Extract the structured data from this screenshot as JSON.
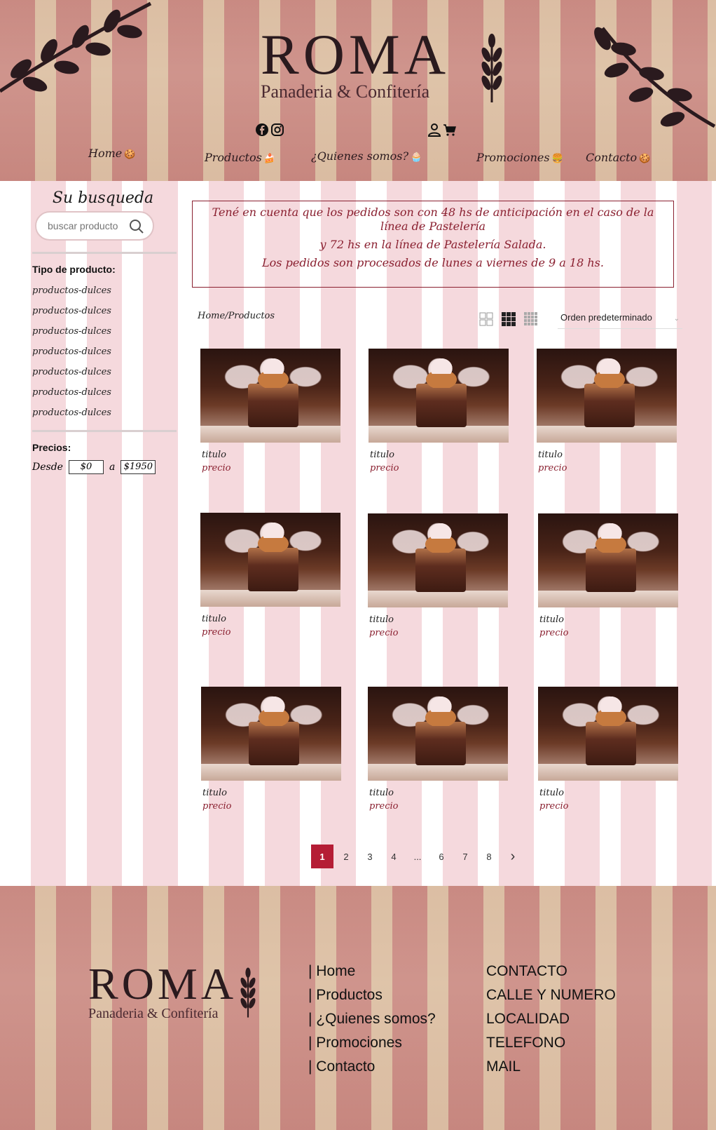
{
  "header": {
    "brand": "ROMA",
    "tagline": "Panaderia & Confitería",
    "nav": [
      {
        "label": "Home"
      },
      {
        "label": "Productos"
      },
      {
        "label": "¿Quienes somos?"
      },
      {
        "label": "Promociones"
      },
      {
        "label": "Contacto"
      }
    ]
  },
  "sidebar": {
    "title": "Su busqueda",
    "search_placeholder": "buscar producto",
    "product_type_heading": "Tipo de producto:",
    "product_types": [
      "productos-dulces",
      "productos-dulces",
      "productos-dulces",
      "productos-dulces",
      "productos-dulces",
      "productos-dulces",
      "productos-dulces"
    ],
    "prices_heading": "Precios:",
    "from_label": "Desde",
    "from_value": "$0",
    "to_label": "a",
    "to_value": "$1950"
  },
  "notice": {
    "line1": "Tené en cuenta que los pedidos son con 48 hs de anticipación en el caso de la línea de Pastelería",
    "line2": "y 72 hs en la línea de Pastelería Salada.",
    "line3": "Los pedidos son procesados de lunes a viernes de 9 a 18 hs."
  },
  "toolbar": {
    "breadcrumb": "Home/Productos",
    "order_label": "Orden predeterminado"
  },
  "products": [
    {
      "title": "titulo",
      "price": "precio"
    },
    {
      "title": "titulo",
      "price": "precio"
    },
    {
      "title": "titulo",
      "price": "precio"
    },
    {
      "title": "titulo",
      "price": "precio"
    },
    {
      "title": "titulo",
      "price": "precio"
    },
    {
      "title": "titulo",
      "price": "precio"
    },
    {
      "title": "titulo",
      "price": "precio"
    },
    {
      "title": "titulo",
      "price": "precio"
    },
    {
      "title": "titulo",
      "price": "precio"
    }
  ],
  "pagination": {
    "pages": [
      "1",
      "2",
      "3",
      "4",
      "...",
      "6",
      "7",
      "8"
    ],
    "current": "1",
    "next": "›"
  },
  "footer": {
    "brand": "ROMA",
    "tagline": "Panaderia & Confitería",
    "nav": [
      "| Home",
      "| Productos",
      "| ¿Quienes somos?",
      "| Promociones",
      "| Contacto"
    ],
    "contact": [
      "CONTACTO",
      "CALLE Y NUMERO",
      "LOCALIDAD",
      "TELEFONO",
      "MAIL"
    ]
  },
  "colors": {
    "accent": "#b51d35",
    "notice_text": "#8a2030",
    "stripe_pink": "#f5d9dd"
  }
}
